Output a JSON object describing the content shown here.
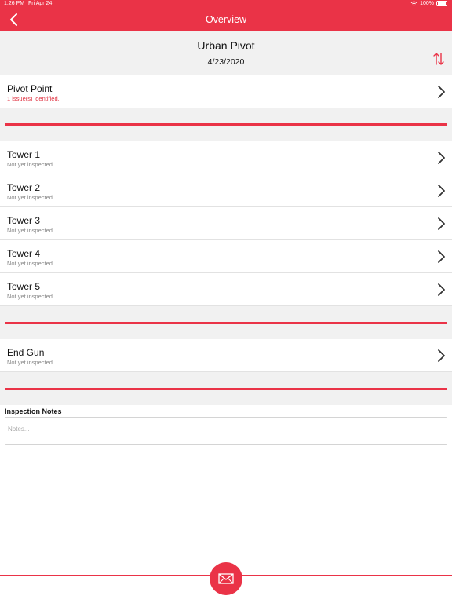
{
  "status_bar": {
    "time": "1:26 PM",
    "date": "Fri Apr 24",
    "battery": "100%"
  },
  "nav": {
    "title": "Overview"
  },
  "header": {
    "site_name": "Urban Pivot",
    "date": "4/23/2020"
  },
  "pivot_point": {
    "label": "Pivot Point",
    "status": "1 issue(s) identified."
  },
  "towers": [
    {
      "label": "Tower 1",
      "status": "Not yet inspected."
    },
    {
      "label": "Tower 2",
      "status": "Not yet inspected."
    },
    {
      "label": "Tower 3",
      "status": "Not yet inspected."
    },
    {
      "label": "Tower 4",
      "status": "Not yet inspected."
    },
    {
      "label": "Tower 5",
      "status": "Not yet inspected."
    }
  ],
  "end_gun": {
    "label": "End Gun",
    "status": "Not yet inspected."
  },
  "notes": {
    "label": "Inspection Notes",
    "placeholder": "Notes...",
    "value": ""
  },
  "colors": {
    "accent": "#ea3347",
    "issue_text": "#e03140",
    "muted_text": "#888888",
    "section_bg": "#f1f1f1"
  },
  "icons": {
    "back": "chevron-left-icon",
    "sort": "sort-arrows-icon",
    "row": "chevron-right-icon",
    "email": "envelope-icon",
    "wifi": "wifi-icon",
    "battery": "battery-icon"
  }
}
